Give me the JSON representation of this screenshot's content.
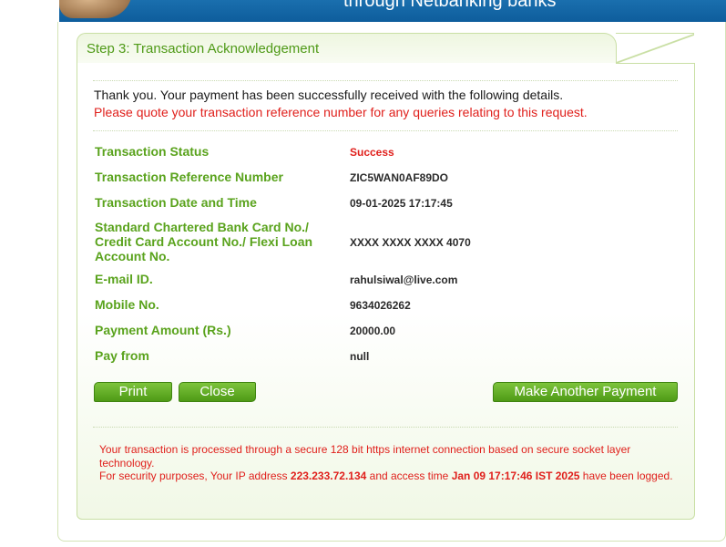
{
  "banner": {
    "text": "through Netbanking banks"
  },
  "step": {
    "title": "Step 3: Transaction Acknowledgement"
  },
  "messages": {
    "thanks": "Thank you. Your payment has been successfully received with the following details.",
    "quote": "Please quote your transaction reference number for any queries relating to this request."
  },
  "details": [
    {
      "label": "Transaction Status",
      "value": "Success"
    },
    {
      "label": "Transaction Reference Number",
      "value": "ZIC5WAN0AF89DO"
    },
    {
      "label": "Transaction Date and Time",
      "value": "09-01-2025 17:17:45"
    },
    {
      "label": "Standard Chartered Bank Card No./ Credit Card Account No./ Flexi Loan Account No.",
      "value": "XXXX XXXX XXXX 4070"
    },
    {
      "label": "E-mail ID.",
      "value": "rahulsiwal@live.com"
    },
    {
      "label": "Mobile No.",
      "value": "9634026262"
    },
    {
      "label": "Payment Amount (Rs.)",
      "value": "20000.00"
    },
    {
      "label": "Pay from",
      "value": "null"
    }
  ],
  "buttons": {
    "print": "Print",
    "close": "Close",
    "another": "Make Another Payment"
  },
  "security": {
    "line1": "Your transaction is processed through a secure 128 bit https internet connection based on secure socket layer technology.",
    "line2_prefix": "For security purposes, Your IP address ",
    "ip": "223.233.72.134",
    "line2_mid": " and access time ",
    "access_time": "Jan 09 17:17:46 IST 2025",
    "line2_suffix": " have been logged."
  },
  "colors": {
    "accent_green": "#5aa31d",
    "alert_red": "#e0201c",
    "banner_blue": "#0e5d9c"
  }
}
